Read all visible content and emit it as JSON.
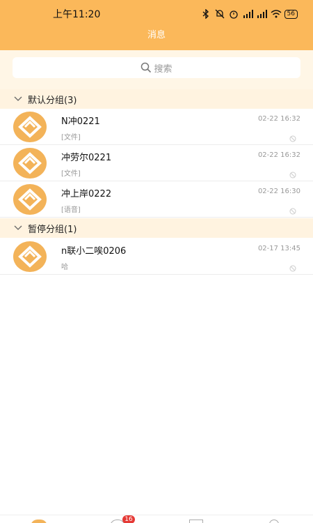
{
  "status_bar": {
    "time": "上午11:20",
    "hd_label": "HD",
    "battery": "56"
  },
  "header": {
    "title": "消息"
  },
  "search": {
    "placeholder": "搜索"
  },
  "groups": [
    {
      "label": "默认分组(3)",
      "items": [
        {
          "name": "N冲0221",
          "preview": "[文件]",
          "time": "02-22 16:32"
        },
        {
          "name": "冲劳尔0221",
          "preview": "[文件]",
          "time": "02-22 16:32"
        },
        {
          "name": "冲上岸0222",
          "preview": "[语音]",
          "time": "02-22 16:30"
        }
      ]
    },
    {
      "label": "暂停分组(1)",
      "items": [
        {
          "name": "n联小二唉0206",
          "preview": "哈",
          "time": "02-17 13:45"
        }
      ]
    }
  ],
  "tabbar": {
    "badge": "16"
  },
  "colors": {
    "accent": "#fbb85a",
    "group_bg": "#fff3e0",
    "badge": "#e53935"
  }
}
